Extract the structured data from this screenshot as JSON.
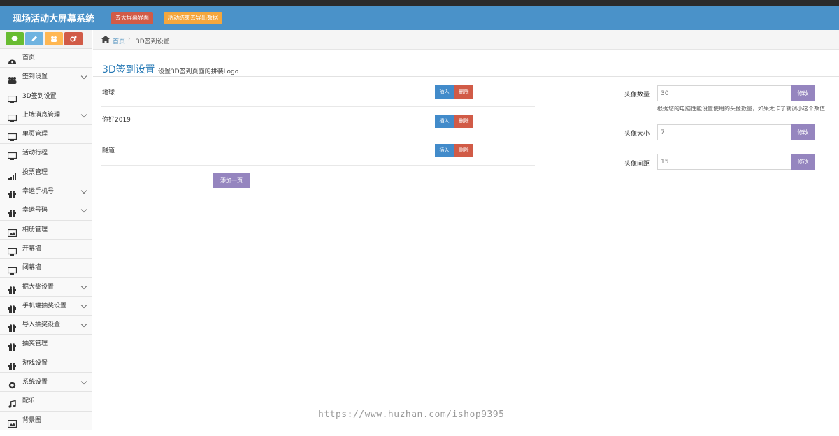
{
  "header": {
    "title": "现场活动大屏幕系统",
    "btn_screen": "去大屏幕界面",
    "btn_export": "活动结束去导出数据"
  },
  "sidebar": {
    "items": [
      {
        "label": "首页",
        "icon": "dashboard-icon",
        "expandable": false
      },
      {
        "label": "签到设置",
        "icon": "users-icon",
        "expandable": true
      },
      {
        "label": "3D签到设置",
        "icon": "desktop-icon",
        "expandable": false
      },
      {
        "label": "上墙消息管理",
        "icon": "desktop-icon",
        "expandable": true
      },
      {
        "label": "单页管理",
        "icon": "desktop-icon",
        "expandable": false
      },
      {
        "label": "活动行程",
        "icon": "desktop-icon",
        "expandable": false
      },
      {
        "label": "投票管理",
        "icon": "signal-icon",
        "expandable": false
      },
      {
        "label": "幸运手机号",
        "icon": "gift-icon",
        "expandable": true
      },
      {
        "label": "幸运号码",
        "icon": "gift-icon",
        "expandable": true
      },
      {
        "label": "相册管理",
        "icon": "picture-icon",
        "expandable": false
      },
      {
        "label": "开幕墙",
        "icon": "desktop-icon",
        "expandable": false
      },
      {
        "label": "闭幕墙",
        "icon": "desktop-icon",
        "expandable": false
      },
      {
        "label": "掘大奖设置",
        "icon": "gift-icon",
        "expandable": true
      },
      {
        "label": "手机端抽奖设置",
        "icon": "gift-icon",
        "expandable": true
      },
      {
        "label": "导入抽奖设置",
        "icon": "gift-icon",
        "expandable": true
      },
      {
        "label": "抽奖管理",
        "icon": "gift-icon",
        "expandable": false
      },
      {
        "label": "游戏设置",
        "icon": "gift-icon",
        "expandable": false
      },
      {
        "label": "系统设置",
        "icon": "cog-icon",
        "expandable": true
      },
      {
        "label": "配乐",
        "icon": "music-icon",
        "expandable": false
      },
      {
        "label": "背景图",
        "icon": "picture-icon",
        "expandable": false
      }
    ]
  },
  "breadcrumb": {
    "home": "首页",
    "current": "3D签到设置"
  },
  "page": {
    "title": "3D签到设置",
    "subtitle": "设置3D签到页面的拼装Logo"
  },
  "rows": [
    {
      "label": "地球",
      "insert": "插入",
      "delete": "删除"
    },
    {
      "label": "你好2019",
      "insert": "插入",
      "delete": "删除"
    },
    {
      "label": "隧道",
      "insert": "插入",
      "delete": "删除"
    }
  ],
  "add_page": "添加一页",
  "settings": {
    "count": {
      "label": "头像数量",
      "value": "30",
      "button": "修改",
      "help": "根据您的电脑性能设置使用的头像数量，如果太卡了就调小这个数值"
    },
    "size": {
      "label": "头像大小",
      "value": "7",
      "button": "修改"
    },
    "gap": {
      "label": "头像间距",
      "value": "15",
      "button": "修改"
    }
  },
  "watermark": "https://www.huzhan.com/ishop9395"
}
